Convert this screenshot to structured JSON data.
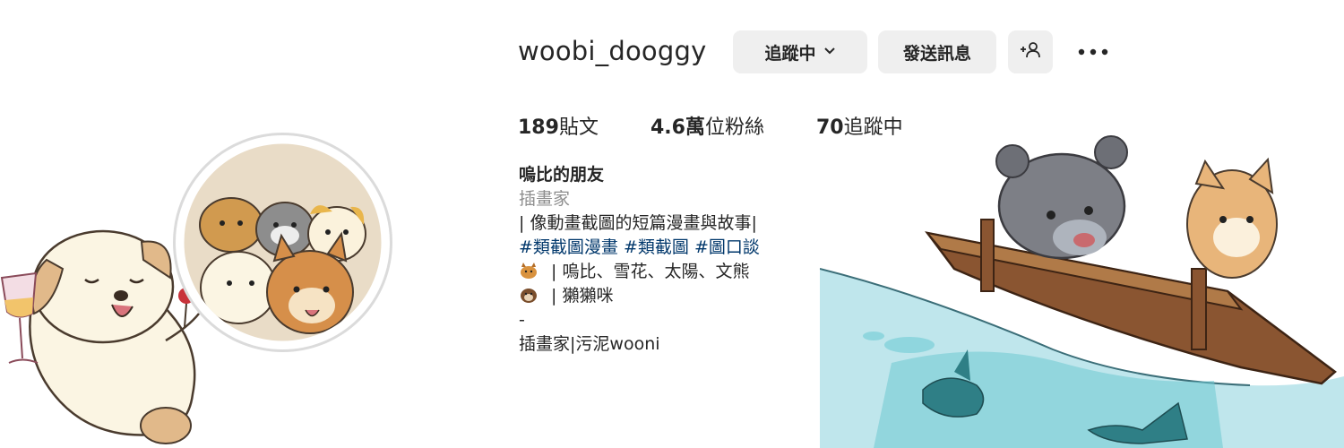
{
  "profile": {
    "username": "woobi_dooggy",
    "following_button": "追蹤中",
    "message_button": "發送訊息"
  },
  "stats": {
    "posts_count": "189",
    "posts_label": "貼文",
    "followers_count": "4.6萬",
    "followers_label": "位粉絲",
    "following_count": "70",
    "following_label": "追蹤中"
  },
  "bio": {
    "display_name": "嗚比的朋友",
    "category": "插畫家",
    "line1": "| 像動畫截圖的短篇漫畫與故事|",
    "hashtags": [
      "#類截圖漫畫",
      "#類截圖",
      "#圖口談"
    ],
    "line_characters": " | 嗚比、雪花、太陽、文熊",
    "line_otter": " | 獺獺咪",
    "separator": "-",
    "footer": "插畫家|污泥wooni"
  },
  "icons": {
    "following_chevron": "chevron-down-icon",
    "add_user": "person-plus-icon",
    "more": "more-horizontal-icon",
    "emoji1": "dog-emoji-icon",
    "emoji2": "otter-emoji-icon"
  },
  "colors": {
    "button_bg": "#efefef",
    "hashtag": "#00376b",
    "category": "#8e8e8e",
    "text": "#262626"
  }
}
